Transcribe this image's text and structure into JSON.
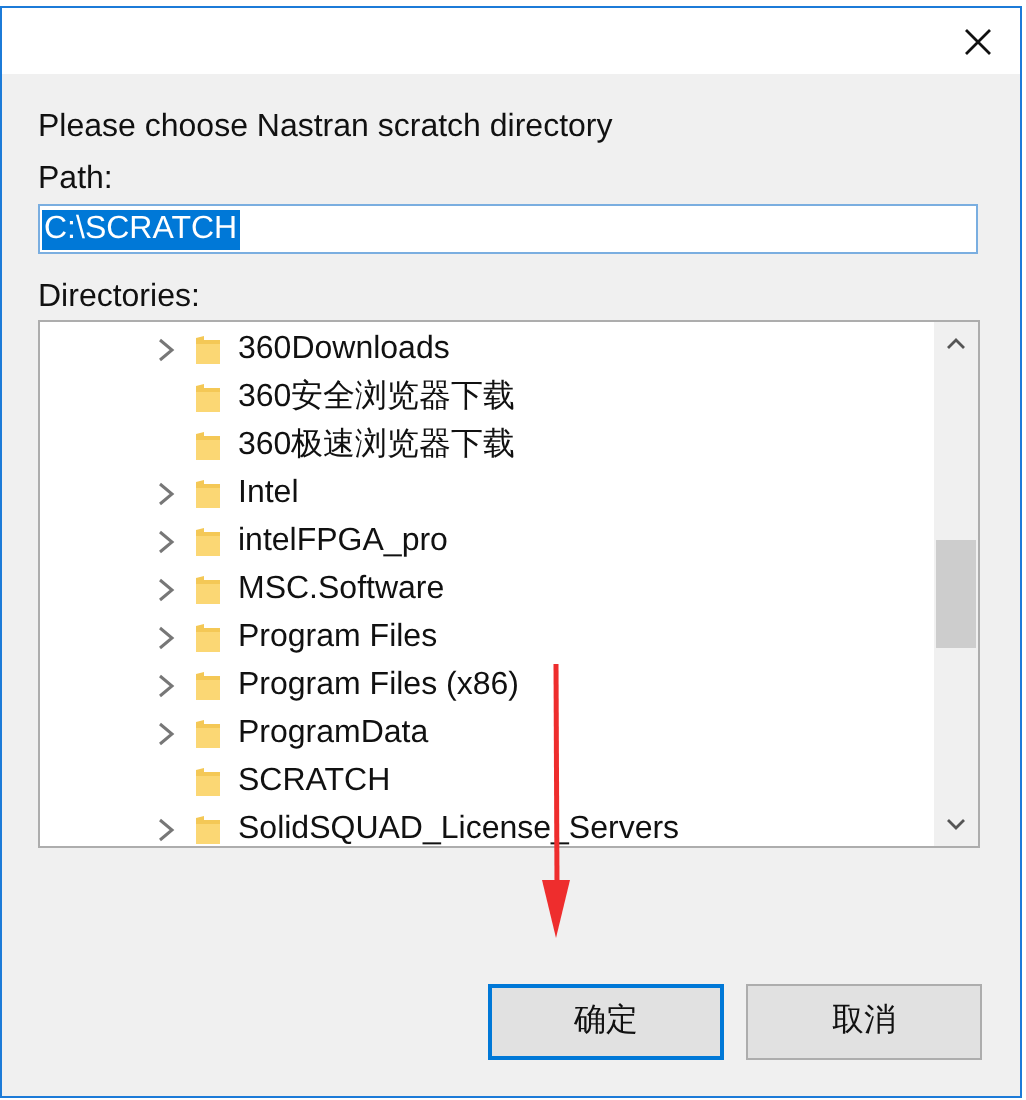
{
  "prompt": "Please choose Nastran scratch directory",
  "path": {
    "label": "Path:",
    "value": "C:\\SCRATCH",
    "text_selected": true
  },
  "directories": {
    "label": "Directories:",
    "items": [
      {
        "name": "360Downloads",
        "expandable": true
      },
      {
        "name": "360安全浏览器下载",
        "expandable": false
      },
      {
        "name": "360极速浏览器下载",
        "expandable": false
      },
      {
        "name": "Intel",
        "expandable": true
      },
      {
        "name": "intelFPGA_pro",
        "expandable": true
      },
      {
        "name": "MSC.Software",
        "expandable": true
      },
      {
        "name": "Program Files",
        "expandable": true
      },
      {
        "name": "Program Files (x86)",
        "expandable": true
      },
      {
        "name": "ProgramData",
        "expandable": true
      },
      {
        "name": "SCRATCH",
        "expandable": false
      },
      {
        "name": "SolidSQUAD_License_Servers",
        "expandable": true
      }
    ]
  },
  "buttons": [
    {
      "label": "确定",
      "default": true
    },
    {
      "label": "取消",
      "default": false
    }
  ],
  "annotation_arrow": true
}
